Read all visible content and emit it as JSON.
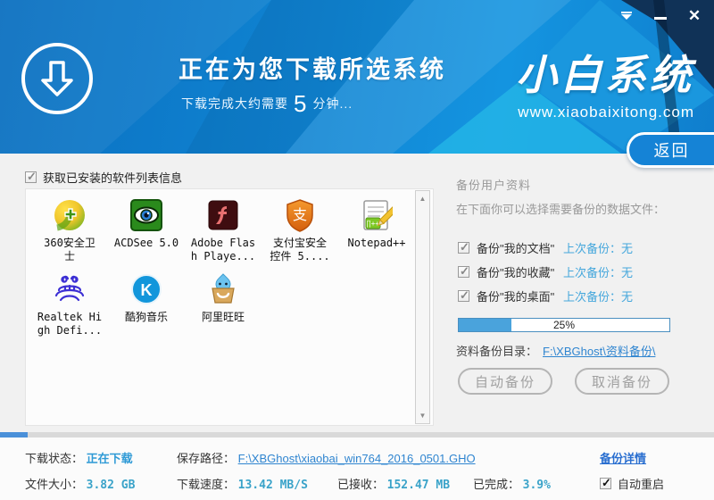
{
  "window": {
    "controls": {
      "tray": "tray",
      "minimize": "minimize",
      "close": "✕"
    }
  },
  "header": {
    "title": "正在为您下载所选系统",
    "subtitle_prefix": "下载完成大约需要",
    "subtitle_minutes": "5",
    "subtitle_suffix": "分钟...",
    "logo_text": "小白系统",
    "logo_url": "www.xiaobaixitong.com",
    "back_button": "返回"
  },
  "software_section": {
    "checkbox_label": "获取已安装的软件列表信息",
    "apps": [
      {
        "label": "360安全卫\n士"
      },
      {
        "label": "ACDSee 5.0"
      },
      {
        "label": "Adobe Flas\nh Playe..."
      },
      {
        "label": "支付宝安全\n控件 5...."
      },
      {
        "label": "Notepad++"
      },
      {
        "label": "Realtek Hi\ngh Defi..."
      },
      {
        "label": "酷狗音乐"
      },
      {
        "label": "阿里旺旺"
      }
    ],
    "kugou_letter": "K",
    "alipay_char": "支"
  },
  "backup_section": {
    "title": "备份用户资料",
    "subtitle": "在下面你可以选择需要备份的数据文件：",
    "items": [
      {
        "label": "备份\"我的文档\"",
        "last": "上次备份：无"
      },
      {
        "label": "备份\"我的收藏\"",
        "last": "上次备份：无"
      },
      {
        "label": "备份\"我的桌面\"",
        "last": "上次备份：无"
      }
    ],
    "progress_percent": "25%",
    "dir_label": "资料备份目录：",
    "dir_link": "F:\\XBGhost\\资料备份\\",
    "auto_button": "自动备份",
    "cancel_button": "取消备份"
  },
  "status_bar": {
    "download_state_label": "下载状态：",
    "download_state_value": "正在下载",
    "save_path_label": "保存路径：",
    "save_path_link": "F:\\XBGhost\\xiaobai_win764_2016_0501.GHO",
    "backup_detail_link": "备份详情",
    "file_size_label": "文件大小：",
    "file_size_value": "3.82 GB",
    "speed_label": "下载速度：",
    "speed_value": "13.42 MB/S",
    "received_label": "已接收：",
    "received_value": "152.47 MB",
    "done_label": "已完成：",
    "done_value": "3.9%",
    "auto_restart_label": "自动重启",
    "overall_percent": "3.9%"
  },
  "colors": {
    "header_blue": "#1085d3",
    "dark_corner": "#103257",
    "accent_link": "#2f85d0",
    "value_teal": "#3aa3c9",
    "progress_fill": "#4aa3dc"
  }
}
